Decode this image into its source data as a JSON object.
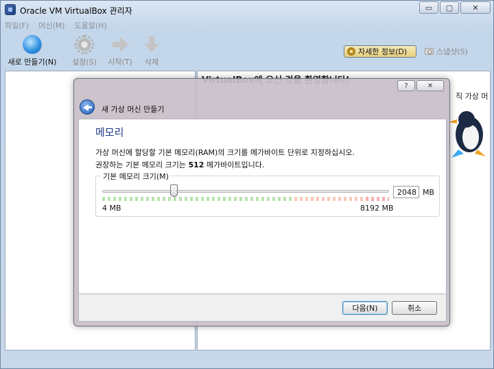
{
  "window": {
    "title": "Oracle VM VirtualBox 관리자",
    "minimize": "▭",
    "maximize": "▢",
    "close": "✕"
  },
  "menu": [
    "파일(F)",
    "머신(M)",
    "도움말(H)"
  ],
  "toolbar": {
    "new_label": "새로 만들기(N)",
    "settings_label": "설정(S)",
    "start_label": "시작(T)",
    "delete_label": "삭제",
    "details_label": "자세한 정보(D)",
    "snapshots_label": "스냅샷(S)"
  },
  "welcome": {
    "heading": "VirtualBox에 오신 것을 환영합니다!",
    "trailing_text": "직 가상 머"
  },
  "wizard": {
    "title": "새 가상 머신 만들기",
    "help": "?",
    "close": "✕",
    "section_title": "메모리",
    "description_1": "가상 머신에 할당할 기본 메모리(RAM)의 크기를 메가바이트 단위로 지정하십시오.",
    "description_2_prefix": "권장하는 기본 메모리 크기는 ",
    "description_2_value": "512",
    "description_2_suffix": " 메가바이트입니다.",
    "group_label": "기본 메모리 크기(M)",
    "memory_value": "2048",
    "memory_fraction": 0.25,
    "unit": "MB",
    "min_label": "4 MB",
    "max_label": "8192 MB",
    "next_label": "다음(N)",
    "cancel_label": "취소"
  },
  "colors": {
    "accent": "#1e3a8a",
    "slider_safe": "#8ad07a",
    "slider_warn": "#f2a58a",
    "slider_danger": "#f27c7c"
  }
}
